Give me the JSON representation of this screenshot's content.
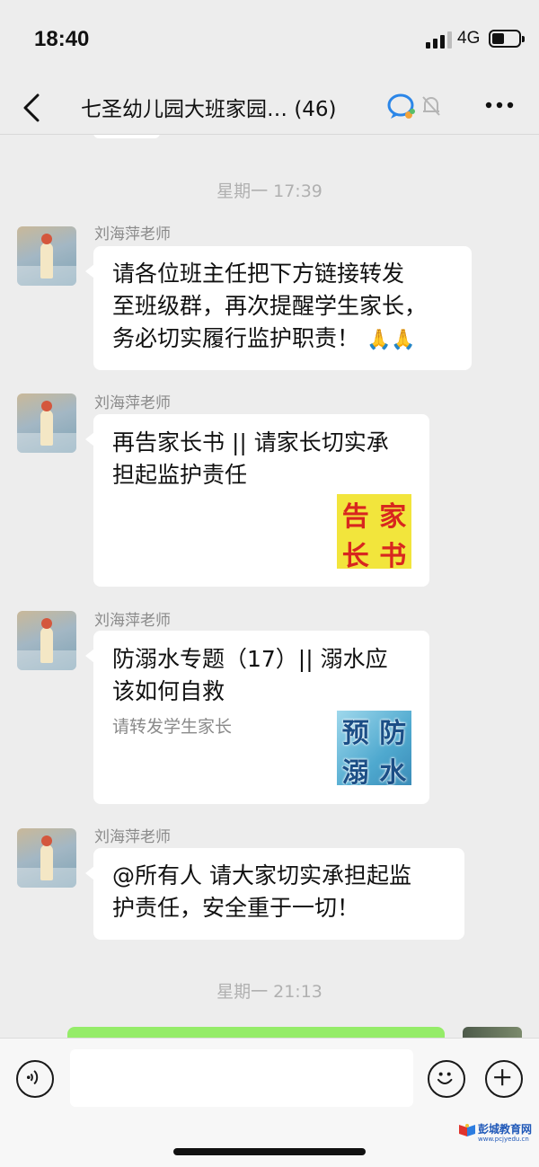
{
  "status_bar": {
    "time": "18:40",
    "network": "4G"
  },
  "nav": {
    "title": "七圣幼儿园大班家园…",
    "count": "(46)"
  },
  "chat": {
    "timestamp_1": "星期一 17:39",
    "timestamp_2": "星期一 21:13",
    "messages": [
      {
        "sender": "刘海萍老师",
        "lines": [
          "请各位班主任把下方链接转发",
          "至班级群，再次提醒学生家长，",
          "务必切实履行监护职责！"
        ],
        "emoji": "🙏🙏"
      },
      {
        "sender": "刘海萍老师",
        "card_lines": [
          "再告家长书 || 请家长切实承",
          "担起监护责任"
        ],
        "thumb_chars": [
          "告",
          "家",
          "长",
          "书"
        ]
      },
      {
        "sender": "刘海萍老师",
        "card_lines": [
          "防溺水专题（17）|| 溺水应",
          "该如何自救"
        ],
        "desc": "请转发学生家长",
        "thumb_chars": [
          "预",
          "防",
          "溺",
          "水"
        ]
      },
      {
        "sender": "刘海萍老师",
        "lines": [
          "@所有人  请大家切实承担起监",
          "护责任，安全重于一切！"
        ]
      }
    ]
  },
  "watermark": {
    "text": "彭城教育网",
    "url": "www.pcjyedu.cn"
  },
  "colors": {
    "background": "#ededed",
    "bubble": "#ffffff",
    "outgoing": "#95ec69",
    "meta": "#8a8a8a"
  }
}
